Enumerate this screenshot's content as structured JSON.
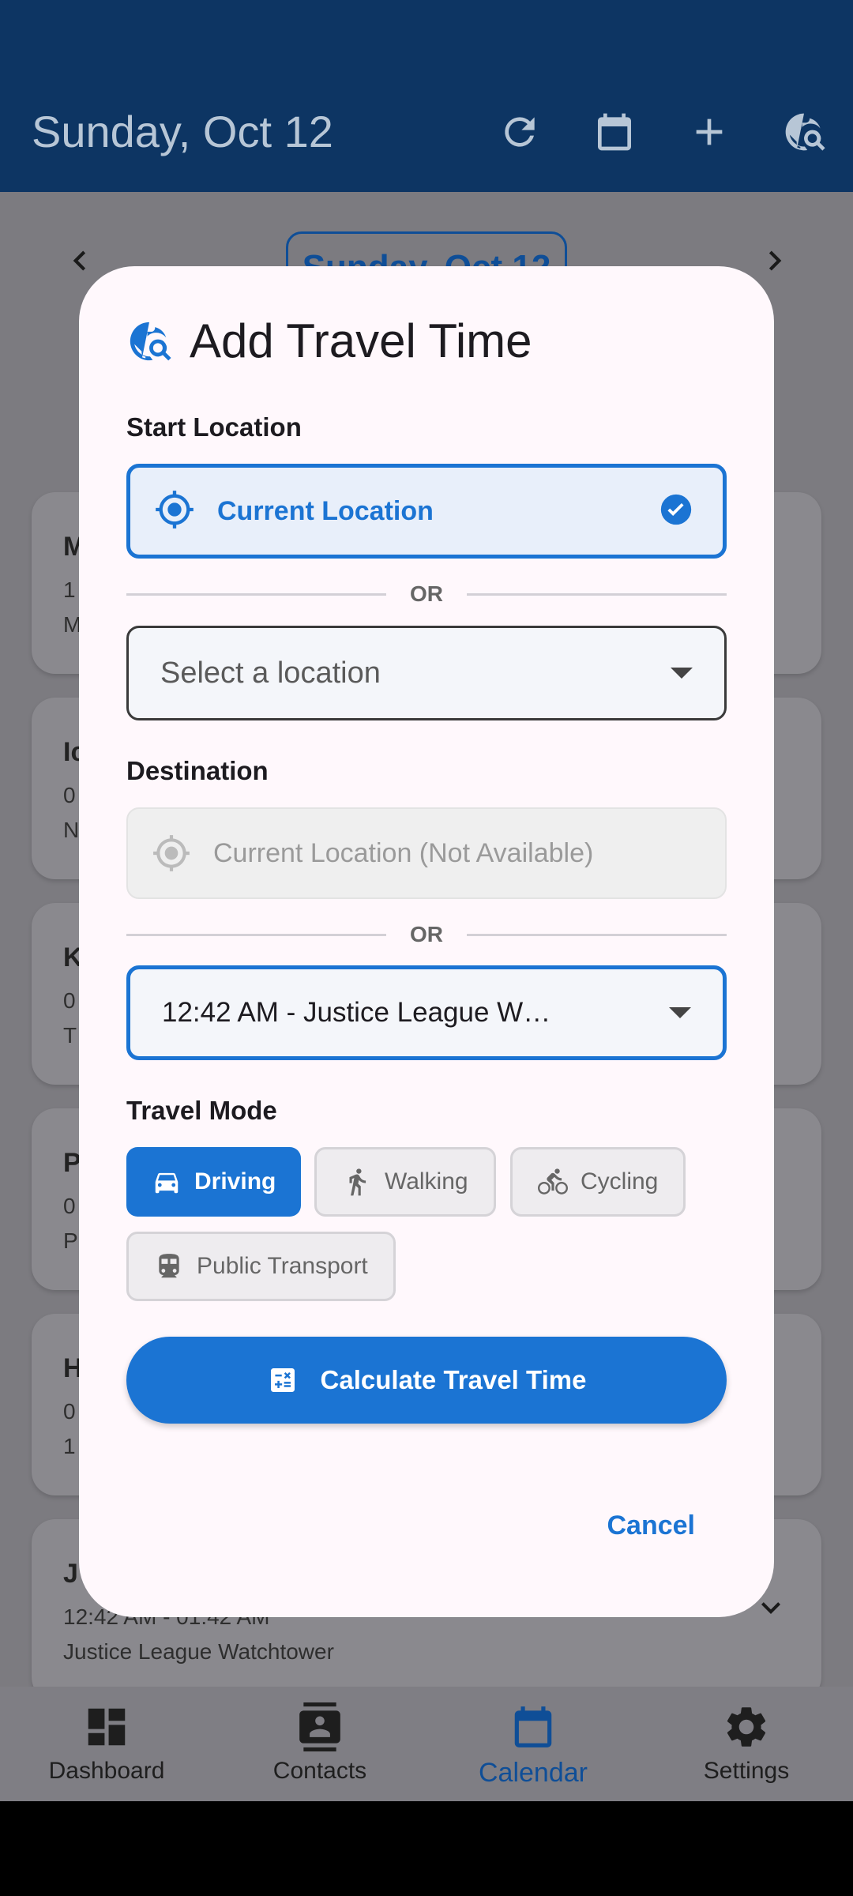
{
  "appbar": {
    "title": "Sunday, Oct 12",
    "icons": [
      "refresh-icon",
      "calendar-icon",
      "add-icon",
      "travel-search-icon"
    ]
  },
  "background": {
    "date_pill": "Sunday, Oct 12",
    "events": [
      {
        "title": "M",
        "line1": "1",
        "line2": "M"
      },
      {
        "title": "Ic",
        "line1": "0",
        "line2": "N"
      },
      {
        "title": "K",
        "line1": "0",
        "line2": "T"
      },
      {
        "title": "P",
        "line1": "0",
        "line2": "P"
      },
      {
        "title": "H",
        "line1": "0",
        "line2": "1"
      },
      {
        "title": "J",
        "line1": "12:42 AM - 01:42 AM",
        "line2": "Justice League Watchtower"
      }
    ]
  },
  "bottom_nav": {
    "items": [
      {
        "label": "Dashboard",
        "icon": "dashboard-icon"
      },
      {
        "label": "Contacts",
        "icon": "contacts-icon"
      },
      {
        "label": "Calendar",
        "icon": "calendar-icon",
        "active": true
      },
      {
        "label": "Settings",
        "icon": "gear-icon"
      }
    ]
  },
  "dialog": {
    "title": "Add Travel Time",
    "start_label": "Start Location",
    "start_current": "Current Location",
    "or_label": "OR",
    "start_select_placeholder": "Select a location",
    "destination_label": "Destination",
    "dest_current_disabled": "Current Location (Not Available)",
    "dest_select_value": "12:42 AM - Justice League W…",
    "mode_label": "Travel Mode",
    "modes": [
      {
        "label": "Driving",
        "icon": "car-icon",
        "selected": true
      },
      {
        "label": "Walking",
        "icon": "walking-icon",
        "selected": false
      },
      {
        "label": "Cycling",
        "icon": "cycling-icon",
        "selected": false
      },
      {
        "label": "Public Transport",
        "icon": "train-icon",
        "selected": false
      }
    ],
    "calculate_label": "Calculate Travel Time",
    "cancel_label": "Cancel"
  },
  "colors": {
    "primary": "#1B74D3",
    "appbar": "#0D3563",
    "dialog_bg": "#FFF8FC"
  }
}
